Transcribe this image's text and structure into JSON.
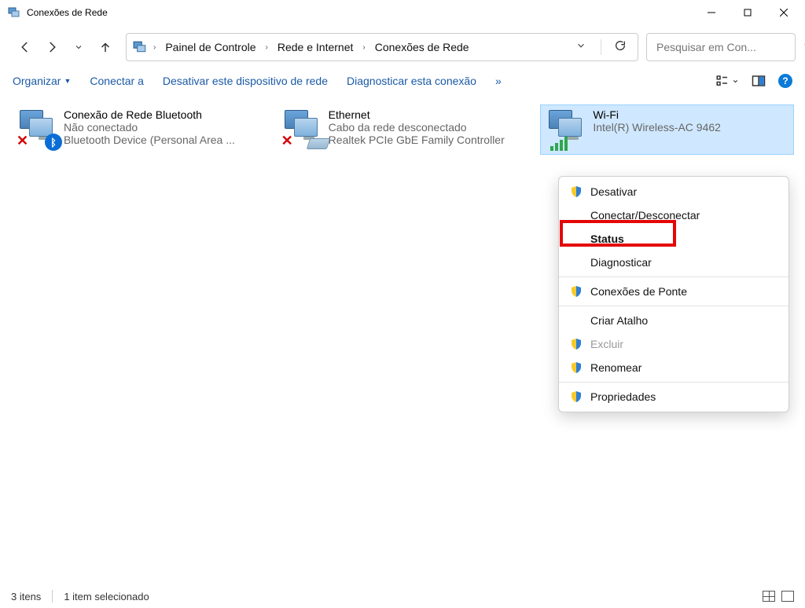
{
  "window": {
    "title": "Conexões de Rede"
  },
  "breadcrumb": {
    "items": [
      "Painel de Controle",
      "Rede e Internet",
      "Conexões de Rede"
    ]
  },
  "search": {
    "placeholder": "Pesquisar em Con..."
  },
  "toolbar": {
    "organize": "Organizar",
    "connect": "Conectar a",
    "disable": "Desativar este dispositivo de rede",
    "diagnose": "Diagnosticar esta conexão",
    "overflow": "»"
  },
  "connections": [
    {
      "name": "Conexão de Rede Bluetooth",
      "status": "Não conectado",
      "device": "Bluetooth Device (Personal Area ...",
      "kind": "bluetooth"
    },
    {
      "name": "Ethernet",
      "status": "Cabo da rede desconectado",
      "device": "Realtek PCIe GbE Family Controller",
      "kind": "ethernet"
    },
    {
      "name": "Wi-Fi",
      "status": " ",
      "device": "Intel(R) Wireless-AC 9462",
      "kind": "wifi"
    }
  ],
  "context_menu": {
    "disable": "Desativar",
    "connect": "Conectar/Desconectar",
    "status": "Status",
    "diagnose": "Diagnosticar",
    "bridge": "Conexões de Ponte",
    "shortcut": "Criar Atalho",
    "delete": "Excluir",
    "rename": "Renomear",
    "properties": "Propriedades"
  },
  "statusbar": {
    "count": "3 itens",
    "selected": "1 item selecionado"
  }
}
